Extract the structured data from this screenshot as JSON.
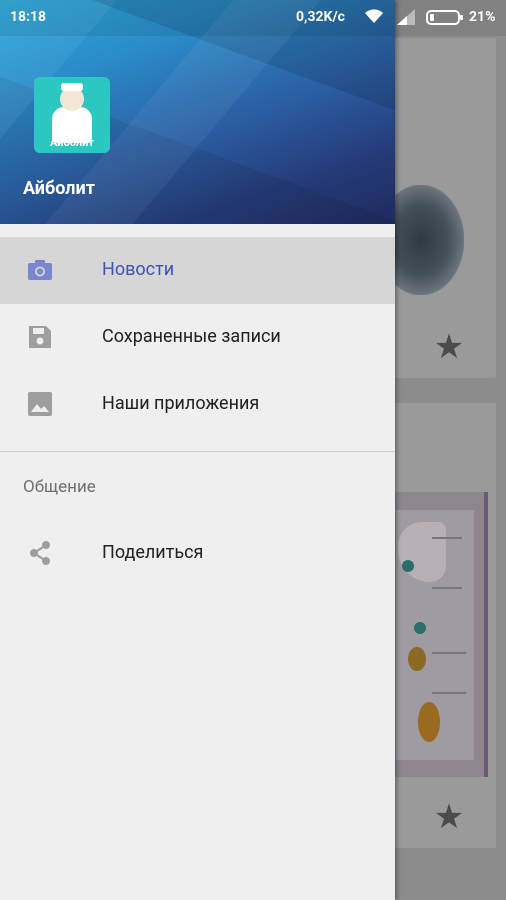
{
  "status_bar": {
    "time": "18:18",
    "network_speed": "0,32K/c",
    "battery_percent": "21%"
  },
  "drawer": {
    "app_name": "Айболит",
    "logo_label": "Айболит",
    "menu": [
      {
        "label": "Новости",
        "icon": "camera-icon",
        "active": true
      },
      {
        "label": "Сохраненные записи",
        "icon": "save-icon",
        "active": false
      },
      {
        "label": "Наши приложения",
        "icon": "image-icon",
        "active": false
      }
    ],
    "section_title": "Общение",
    "share": {
      "label": "Поделиться",
      "icon": "share-icon"
    }
  },
  "colors": {
    "accent": "#3f51b5",
    "header_start": "#2ba9db",
    "header_end": "#1f2a5f",
    "active_item_bg": "#d6d6d6",
    "icon_gray": "#9e9e9e"
  }
}
